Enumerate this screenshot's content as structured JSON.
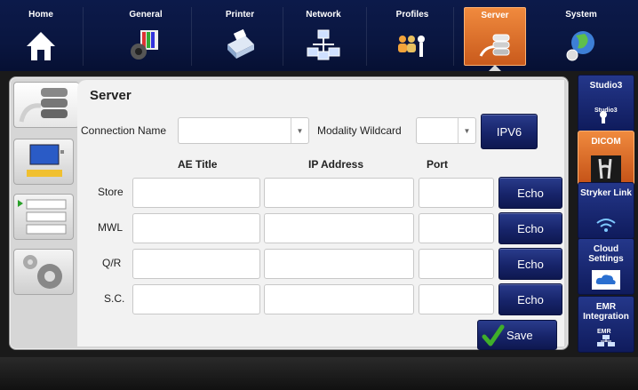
{
  "nav": {
    "tabs": [
      {
        "label": "Home",
        "icon": "home-icon"
      },
      {
        "label": "General",
        "icon": "palette-icon"
      },
      {
        "label": "Printer",
        "icon": "printer-icon"
      },
      {
        "label": "Network",
        "icon": "network-icon"
      },
      {
        "label": "Profiles",
        "icon": "profiles-icon"
      },
      {
        "label": "Server",
        "icon": "server-icon",
        "active": true
      },
      {
        "label": "System",
        "icon": "globe-icon"
      }
    ]
  },
  "page": {
    "title": "Server",
    "connection_name_label": "Connection Name",
    "connection_name_value": "",
    "modality_wildcard_label": "Modality Wildcard",
    "modality_wildcard_value": "",
    "ipv6_label": "IPV6"
  },
  "table": {
    "headers": [
      "AE Title",
      "IP Address",
      "Port"
    ],
    "rows": [
      {
        "label": "Store",
        "ae_title": "",
        "ip": "",
        "port": "",
        "action": "Echo"
      },
      {
        "label": "MWL",
        "ae_title": "",
        "ip": "",
        "port": "",
        "action": "Echo"
      },
      {
        "label": "Q/R",
        "ae_title": "",
        "ip": "",
        "port": "",
        "action": "Echo"
      },
      {
        "label": "S.C.",
        "ae_title": "",
        "ip": "",
        "port": "",
        "action": "Echo"
      }
    ]
  },
  "save_label": "Save",
  "sidebar": {
    "items": [
      {
        "label": "Studio3",
        "icon": "studio3-icon",
        "badge": "Studio3"
      },
      {
        "label": "DICOM",
        "icon": "dicom-icon",
        "active": true
      },
      {
        "label": "Stryker Link",
        "icon": "wifi-icon"
      },
      {
        "label": "Cloud Settings",
        "icon": "cloud-icon"
      },
      {
        "label": "EMR Integration",
        "icon": "emr-icon",
        "badge": "EMR"
      }
    ]
  },
  "colors": {
    "accent_orange": "#e0742c",
    "button_navy": "#17246a",
    "nav_bg": "#0a1640",
    "panel_bg": "#d6d6d6",
    "save_check_green": "#3fae2a"
  }
}
